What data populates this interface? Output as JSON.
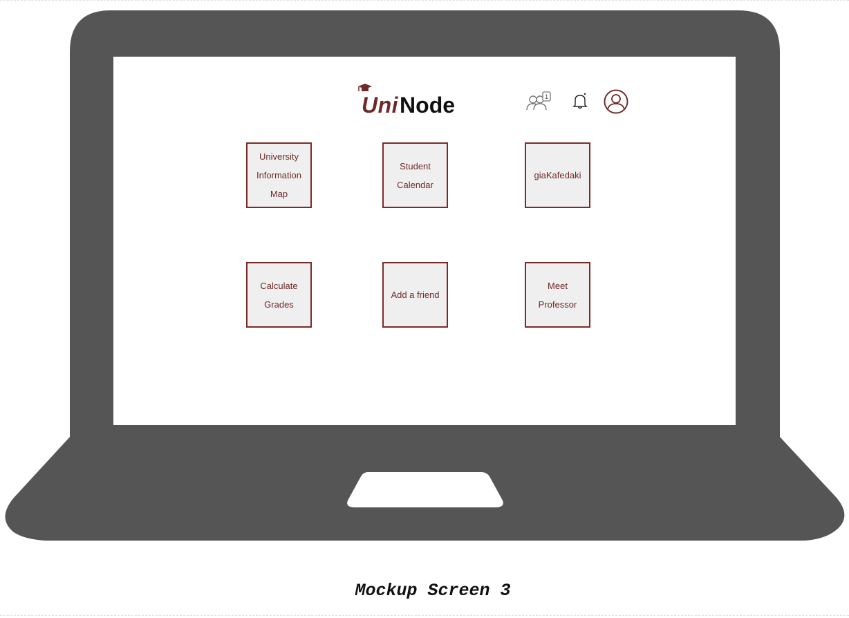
{
  "app": {
    "logo_uni": "Uni",
    "logo_node": "Node"
  },
  "header": {
    "icons": [
      "friends-notification-icon",
      "bell-icon",
      "user-profile-icon"
    ],
    "friends_badge": "1"
  },
  "tiles": [
    {
      "label_lines": [
        "University",
        "Information",
        "Map"
      ]
    },
    {
      "label_lines": [
        "Student",
        "Calendar"
      ]
    },
    {
      "label_lines": [
        "giaKafedaki"
      ]
    },
    {
      "label_lines": [
        "Calculate",
        "Grades"
      ]
    },
    {
      "label_lines": [
        "Add a friend"
      ]
    },
    {
      "label_lines": [
        "Meet",
        "Professor"
      ]
    }
  ],
  "caption": "Mockup Screen 3",
  "colors": {
    "laptop_body": "#555555",
    "accent": "#6e2a29",
    "tile_bg": "#efefef"
  }
}
